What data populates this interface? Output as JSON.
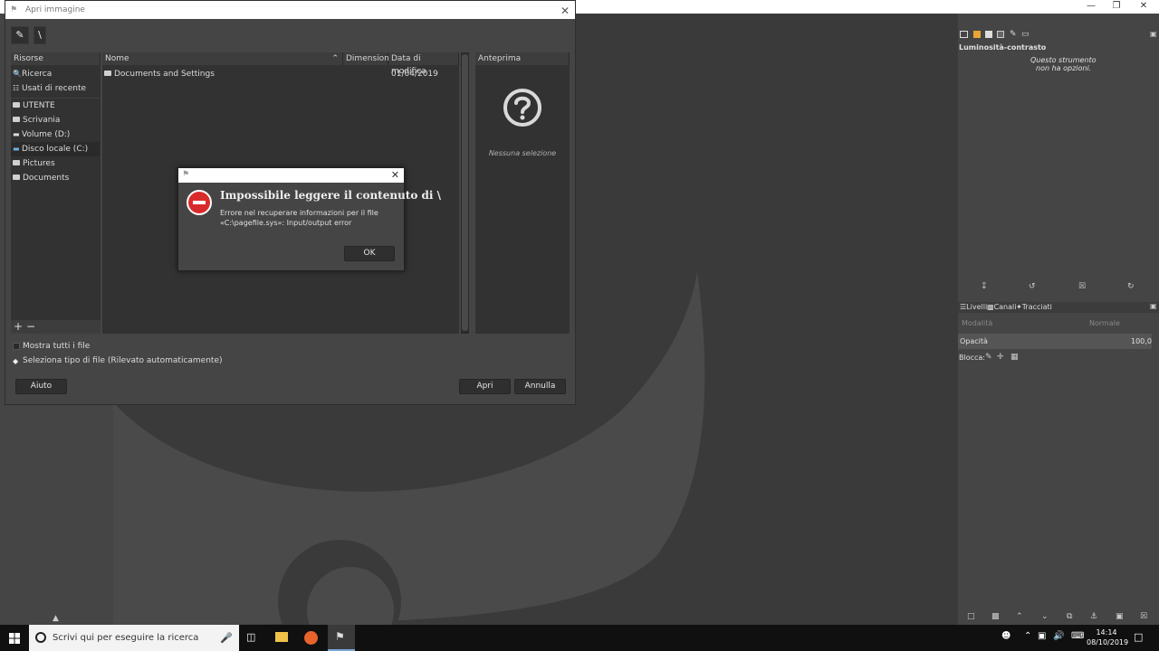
{
  "open_dialog": {
    "title": "Apri immagine",
    "path_label": "\\",
    "places_header": "Risorse",
    "places": [
      {
        "label": "Ricerca",
        "icon": "search-icon"
      },
      {
        "label": "Usati di recente",
        "icon": "recent-icon"
      },
      {
        "label": "UTENTE",
        "icon": "folder-icon"
      },
      {
        "label": "Scrivania",
        "icon": "folder-icon"
      },
      {
        "label": "Volume (D:)",
        "icon": "drive-icon"
      },
      {
        "label": "Disco locale (C:)",
        "icon": "drive-icon"
      },
      {
        "label": "Pictures",
        "icon": "folder-icon"
      },
      {
        "label": "Documents",
        "icon": "folder-icon"
      }
    ],
    "columns": {
      "name": "Nome",
      "size": "Dimensione",
      "modified": "Data di modifica"
    },
    "files": [
      {
        "name": "Documents and Settings",
        "size": "",
        "modified": "01/04/2019"
      }
    ],
    "preview_header": "Anteprima",
    "preview_empty": "Nessuna selezione",
    "show_all_files": "Mostra tutti i file",
    "select_file_type": "Seleziona tipo di file (Rilevato automaticamente)",
    "help_button": "Aiuto",
    "open_button": "Apri",
    "cancel_button": "Annulla"
  },
  "error_dialog": {
    "title": "Impossibile leggere il contenuto di \\",
    "message": "Errore nel recuperare informazioni per il file «C:\\pagefile.sys»: Input/output error",
    "ok_button": "OK"
  },
  "right_panel": {
    "tool_title": "Luminosità-contrasto",
    "tool_note_line1": "Questo strumento",
    "tool_note_line2": "non ha opzioni.",
    "tabs": [
      "Livelli",
      "Canali",
      "Tracciati"
    ],
    "mode_label": "Modalità",
    "mode_value": "Normale",
    "opacity_label": "Opacità",
    "opacity_value": "100,0",
    "lock_label": "Blocca:"
  },
  "taskbar": {
    "search_placeholder": "Scrivi qui per eseguire la ricerca",
    "time": "14:14",
    "date": "08/10/2019"
  },
  "colors": {
    "background": "#454545",
    "canvas": "#3a3a3a",
    "error_red": "#d92b2b"
  }
}
